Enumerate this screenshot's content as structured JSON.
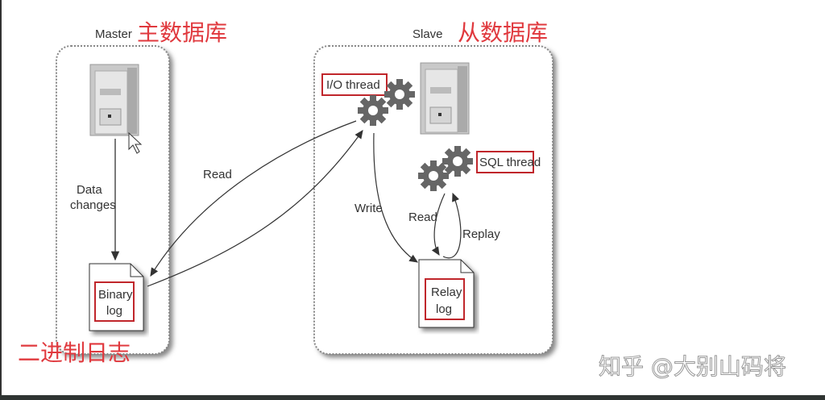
{
  "master": {
    "title": "Master",
    "title_cn": "主数据库",
    "data_changes": [
      "Data",
      "changes"
    ],
    "binary_log": [
      "Binary",
      "log"
    ],
    "binary_log_cn": "二进制日志"
  },
  "slave": {
    "title": "Slave",
    "title_cn": "从数据库",
    "io_thread": "I/O thread",
    "sql_thread": "SQL thread",
    "relay_log": [
      "Relay",
      "log"
    ]
  },
  "arrows": {
    "read": "Read",
    "write": "Write",
    "read2": "Read",
    "replay": "Replay"
  },
  "watermark": "知乎 @大别山码将",
  "colors": {
    "accent": "#e0393e",
    "highlight_box": "#c0262b"
  }
}
